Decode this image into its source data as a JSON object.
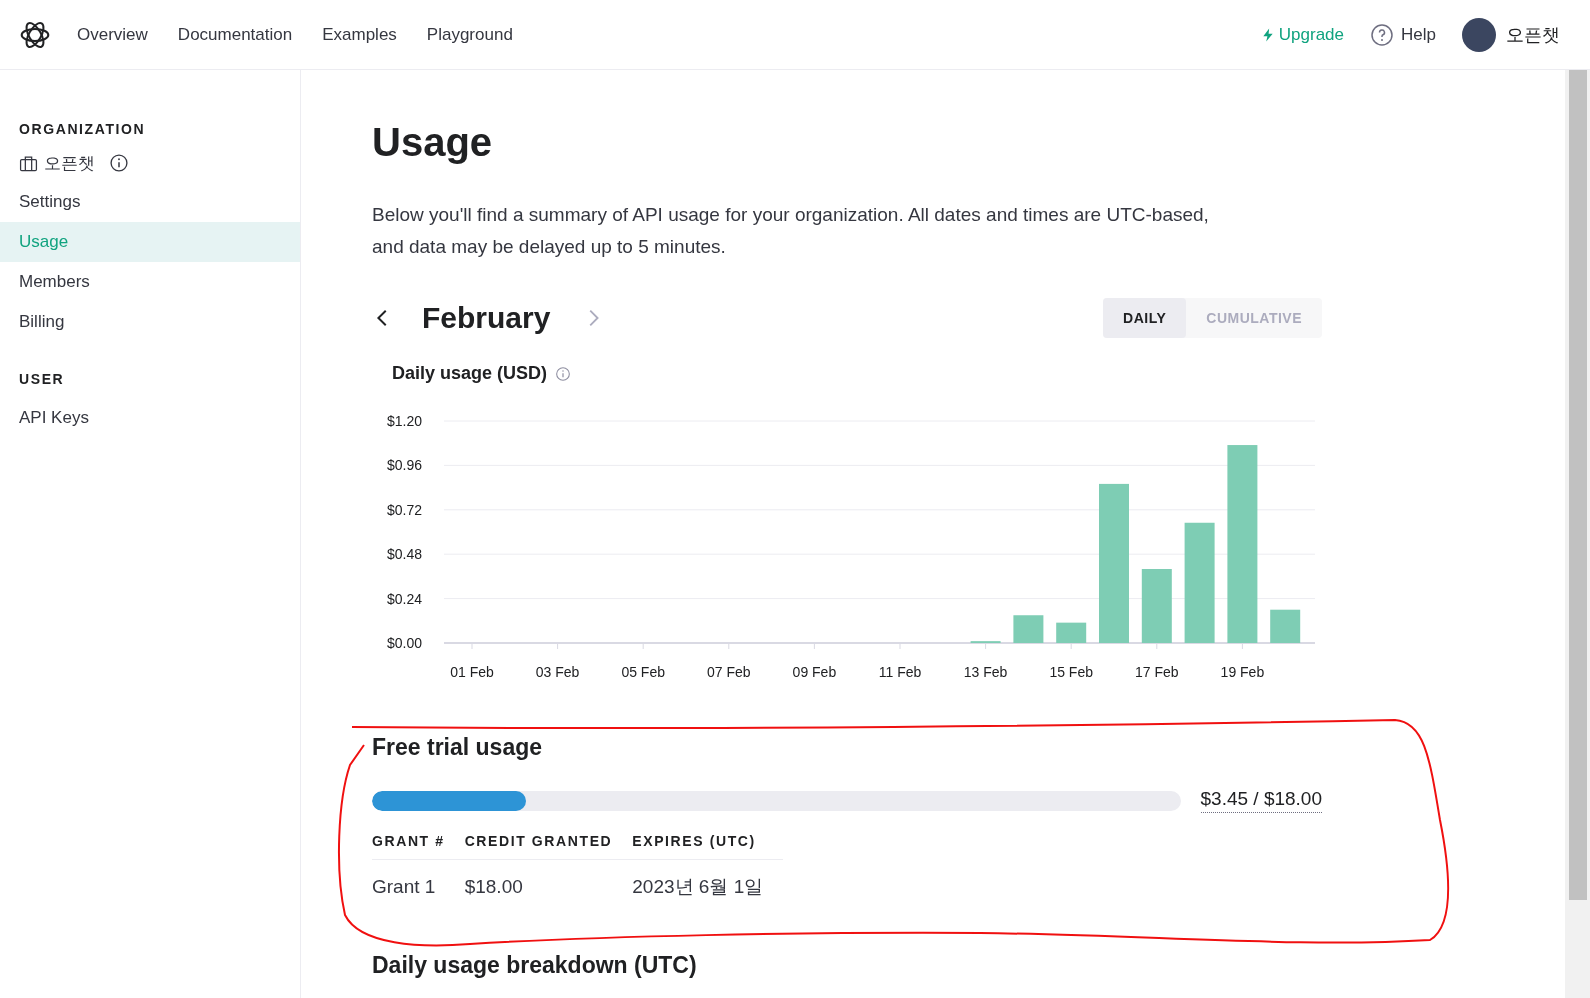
{
  "nav": {
    "links": [
      {
        "label": "Overview"
      },
      {
        "label": "Documentation"
      },
      {
        "label": "Examples"
      },
      {
        "label": "Playground"
      }
    ],
    "upgrade": "Upgrade",
    "help": "Help",
    "user_name": "오픈챗"
  },
  "sidebar": {
    "sections": [
      {
        "heading": "ORGANIZATION",
        "org_name": "오픈챗",
        "items": [
          {
            "label": "Settings",
            "selected": false
          },
          {
            "label": "Usage",
            "selected": true
          },
          {
            "label": "Members",
            "selected": false
          },
          {
            "label": "Billing",
            "selected": false
          }
        ]
      },
      {
        "heading": "USER",
        "items": [
          {
            "label": "API Keys",
            "selected": false
          }
        ]
      }
    ]
  },
  "page": {
    "title": "Usage",
    "description": "Below you'll find a summary of API usage for your organization. All dates and times are UTC-based, and data may be delayed up to 5 minutes.",
    "month": "February",
    "view_toggle": [
      {
        "label": "DAILY",
        "selected": true
      },
      {
        "label": "CUMULATIVE",
        "selected": false
      }
    ],
    "chart_data": {
      "type": "bar",
      "title": "Daily usage (USD)",
      "categories": [
        "01 Feb",
        null,
        "03 Feb",
        null,
        "05 Feb",
        null,
        "07 Feb",
        null,
        "09 Feb",
        null,
        "11 Feb",
        null,
        "13 Feb",
        null,
        "15 Feb",
        null,
        "17 Feb",
        null,
        "19 Feb",
        null
      ],
      "values": [
        0,
        0,
        0,
        0,
        0,
        0,
        0,
        0,
        0,
        0,
        0,
        0,
        0.01,
        0.15,
        0.11,
        0.86,
        0.4,
        0.65,
        1.07,
        0.18
      ],
      "grid": true,
      "ylim": [
        0,
        1.2
      ],
      "yticks": [
        {
          "value": 0,
          "label": "$0.00"
        },
        {
          "value": 0.24,
          "label": "$0.24"
        },
        {
          "value": 0.48,
          "label": "$0.48"
        },
        {
          "value": 0.72,
          "label": "$0.72"
        },
        {
          "value": 0.96,
          "label": "$0.96"
        },
        {
          "value": 1.2,
          "label": "$1.20"
        }
      ]
    }
  },
  "free_trial": {
    "title": "Free trial usage",
    "level": 0.19,
    "reading": "$3.45 / $18.00",
    "columns": [
      "GRANT #",
      "CREDIT GRANTED",
      "EXPIRES (UTC)"
    ],
    "rows": [
      [
        "Grant 1",
        "$18.00",
        "2023년 6월 1일"
      ]
    ]
  },
  "breakdown_title": "Daily usage breakdown (UTC)"
}
